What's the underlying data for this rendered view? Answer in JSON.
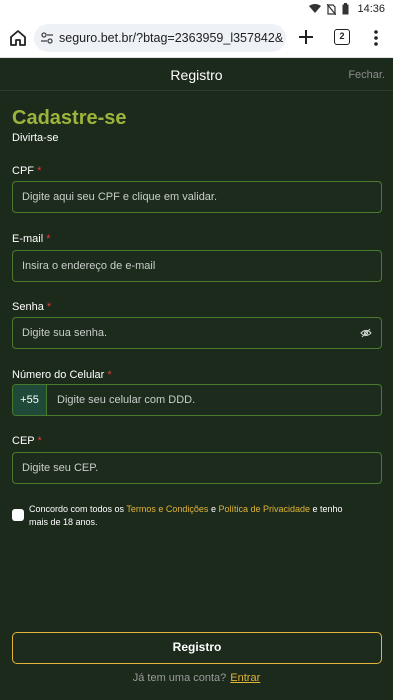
{
  "statusbar": {
    "time": "14:36"
  },
  "browser": {
    "url": "seguro.bet.br/?btag=2363959_l357842&ac",
    "tab_count": "2"
  },
  "header": {
    "title": "Registro",
    "close_label": "Fechar."
  },
  "form": {
    "heading": "Cadastre-se",
    "subheading": "Divirta-se",
    "cpf": {
      "label": "CPF",
      "required": "*",
      "placeholder": "Digite aqui seu CPF e clique em validar."
    },
    "email": {
      "label": "E-mail",
      "required": "*",
      "placeholder": "Insira o endereço de e-mail"
    },
    "password": {
      "label": "Senha",
      "required": "*",
      "placeholder": "Digite sua senha."
    },
    "phone": {
      "label": "Número do Celular",
      "required": "*",
      "prefix": "+55",
      "placeholder": "Digite seu celular com DDD."
    },
    "cep": {
      "label": "CEP",
      "required": "*",
      "placeholder": "Digite seu CEP."
    },
    "terms": {
      "text_1": "Concordo com todos os ",
      "link_terms": "Termos e Condições",
      "text_2": " e ",
      "link_privacy": "Política de Privacidade",
      "text_3": " e tenho mais de 18 anos."
    },
    "submit_label": "Registro",
    "login_prompt": "Já tem uma conta?",
    "login_link": "Entrar"
  },
  "colors": {
    "accent": "#9cb43c",
    "link": "#e0b43a",
    "background": "#1c2a1c",
    "border": "#4b7a2c"
  }
}
